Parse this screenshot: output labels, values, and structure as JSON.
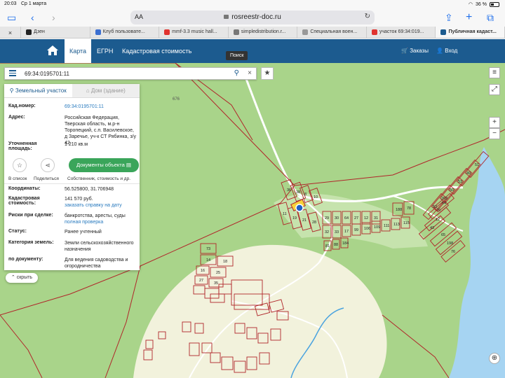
{
  "status_bar": {
    "time": "20:03",
    "date": "Ср 1 марта",
    "battery": "36 %"
  },
  "browser": {
    "address_aa": "AA",
    "url": "rosreestr-doc.ru",
    "tabs": [
      {
        "label": "Дзен",
        "color": "#222222"
      },
      {
        "label": "Клуб пользовате...",
        "color": "#3b6fd1"
      },
      {
        "label": "mmf-3.3 music hall...",
        "color": "#e0332f"
      },
      {
        "label": "simpledistribution.r...",
        "color": "#777777"
      },
      {
        "label": "Специальная воен...",
        "color": "#999999"
      },
      {
        "label": "участок 69:34:019...",
        "color": "#e0332f"
      },
      {
        "label": "Публичная кадаст...",
        "color": "#1c5b8f"
      }
    ]
  },
  "nav": {
    "items": [
      "Карта",
      "ЕГРН",
      "Кадастровая стоимость"
    ],
    "orders": "Заказы",
    "login": "Вход",
    "tooltip": "Поиск"
  },
  "search": {
    "value": "69:34:0195701:11"
  },
  "panel": {
    "tab_land": "Земельный участок",
    "tab_building": "Дом (здание)",
    "cad_label": "Кад.номер:",
    "cad_value": "69:34:0195701:11",
    "addr_label": "Адрес:",
    "addr_value": "Российская Федерация, Тверская область, м.р-н Торопецкий, с.п. Василевское, д Заречье, уч-к СТ Рябинка, з/у 42",
    "area_label": "Уточненная площадь:",
    "area_value": "1 210 кв.м",
    "btn_list": "В список",
    "btn_share": "Поделиться",
    "btn_docs": "Документы объекта",
    "docs_sub": "Собственник, стоимость и др.",
    "coords_label": "Координаты:",
    "coords_value": "56.525800, 31.706948",
    "cost_label": "Кадастровая стоимость:",
    "cost_value": "141 570 руб.",
    "cost_link": "заказать справку на дату",
    "risk_label": "Риски при сделке:",
    "risk_value": "банкротства, аресты, суды",
    "risk_link": "полная проверка",
    "status_label": "Статус:",
    "status_value": "Ранее учтенный",
    "cat_label": "Категория земель:",
    "cat_value": "Земли сельскохозяйственного назначения",
    "use_label": "по документу:",
    "use_value": "Для ведения садоводства и огородничества",
    "hide": "скрыть"
  },
  "map": {
    "road_label": "676",
    "plot_labels": [
      "36",
      "38",
      "8",
      "10",
      "11",
      "19",
      "21",
      "28",
      "29",
      "30",
      "64",
      "27",
      "12",
      "31",
      "32",
      "33",
      "17",
      "99",
      "106",
      "109",
      "111",
      "113",
      "115",
      "81",
      "88",
      "184",
      "188",
      "78",
      "52",
      "203",
      "50",
      "53",
      "49",
      "51",
      "43",
      "12",
      "65",
      "198",
      "76",
      "76",
      "64",
      "73",
      "14",
      "18",
      "16",
      "25",
      "27",
      "35"
    ],
    "colors": {
      "grass": "#a9d48a",
      "clearing": "#f2f2dc",
      "water": "#a6d4f2",
      "boundary": "#b0262a",
      "road": "#ffffff",
      "pin": "#1f5fc4",
      "selected": "#f6d23a"
    }
  }
}
